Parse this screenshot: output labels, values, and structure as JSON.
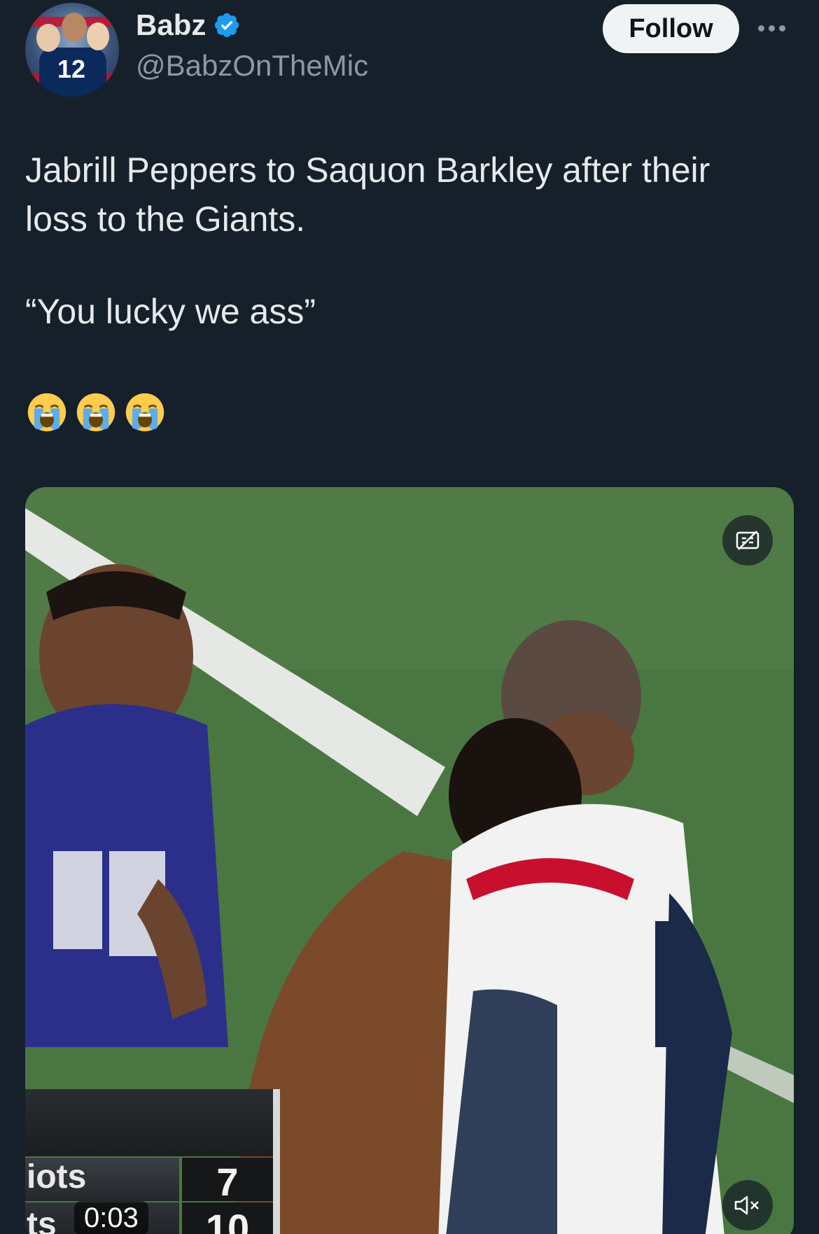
{
  "author": {
    "display_name": "Babz",
    "handle": "@BabzOnTheMic",
    "avatar_jersey_number": "12"
  },
  "actions": {
    "follow_label": "Follow"
  },
  "tweet": {
    "line1": "Jabrill Peppers to Saquon Barkley after their loss to the Giants.",
    "line2": "“You lucky we ass”",
    "emojis": [
      "😭",
      "😭",
      "😭"
    ]
  },
  "video": {
    "timestamp": "0:03",
    "scoreboard": {
      "team1_label": "iots",
      "team1_score": "7",
      "team2_label": "ts",
      "team2_score": "10"
    }
  },
  "colors": {
    "background": "#15202b",
    "text_primary": "#e7e9ea",
    "text_secondary": "#8b98a5",
    "verified_badge": "#1d9bf0",
    "follow_button": "#eff3f4"
  }
}
